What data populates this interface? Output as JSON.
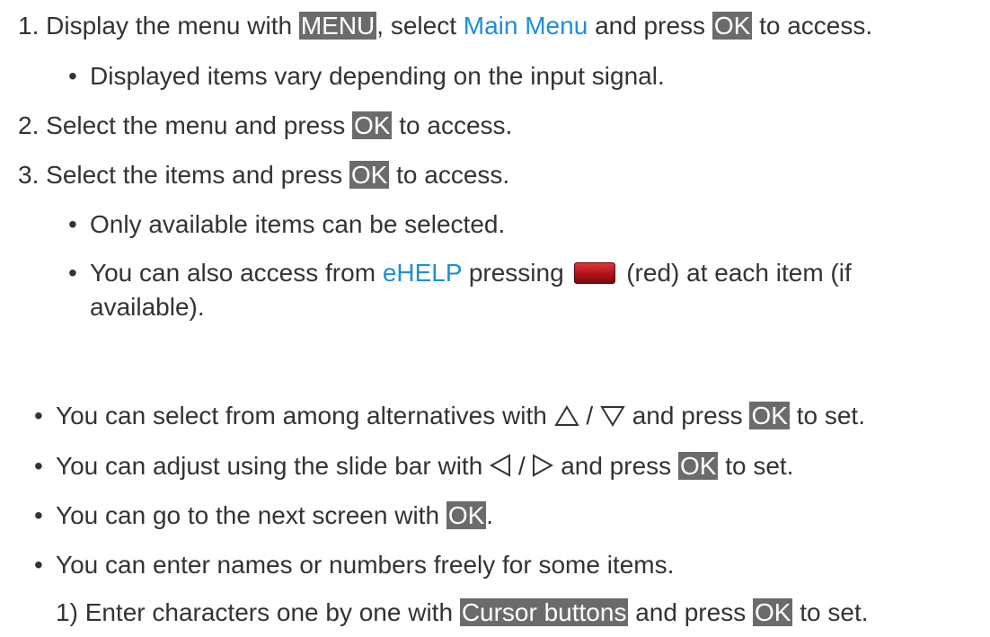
{
  "steps": [
    {
      "num": "1.",
      "text_a": "Display the menu with",
      "key_a": "MENU",
      "text_b": ", select",
      "link": "Main Menu",
      "text_c": "and press",
      "key_b": "OK",
      "text_d": "to access."
    },
    {
      "num": "2.",
      "text_a": "Select the menu and press",
      "key": "OK",
      "text_b": "to access."
    },
    {
      "num": "3.",
      "text_a": "Select the items and press",
      "key": "OK",
      "text_b": "to access."
    }
  ],
  "step1_note": "Displayed items vary depending on the input signal.",
  "step3_notes": {
    "n1": "Only available items can be selected.",
    "n2_text_a": "You can also access from",
    "n2_link": "eHELP",
    "n2_text_b": "pressing",
    "n2_text_c": "(red) at each item (if",
    "n2_text_d": "available)."
  },
  "tips": {
    "t1_a": "You can select from among alternatives with",
    "t1_sep": "/",
    "t1_b": "and press",
    "t1_key": "OK",
    "t1_c": "to set.",
    "t2_a": "You can adjust using the slide bar with",
    "t2_sep": "/",
    "t2_b": "and press",
    "t2_key": "OK",
    "t2_c": "to set.",
    "t3_a": "You can go to the next screen with",
    "t3_key": "OK",
    "t3_b": ".",
    "t4": "You can enter names or numbers freely for some items."
  },
  "substep": {
    "num": "1)",
    "text_a": "Enter characters one by one with",
    "key_a": "Cursor buttons",
    "text_b": "and press",
    "key_b": "OK",
    "text_c": "to set."
  },
  "bullet_glyph": "•",
  "colors": {
    "key_bg": "#6b6b6b",
    "link": "#1e8fd6",
    "red_button": "#b01319",
    "text": "#333333"
  },
  "icons": {
    "up": "up-triangle-icon",
    "down": "down-triangle-icon",
    "left": "left-triangle-icon",
    "right": "right-triangle-icon",
    "red": "red-button-icon"
  }
}
